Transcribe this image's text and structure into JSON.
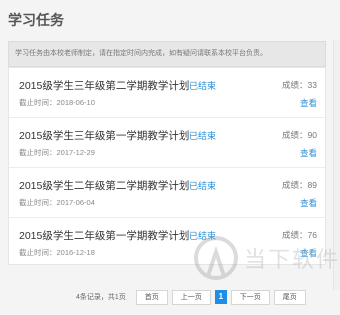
{
  "page": {
    "title": "学习任务"
  },
  "notice": {
    "text": "学习任务由本校老师制定，请在指定时间内完成，如有疑问请联系本校平台负责。"
  },
  "tasks": [
    {
      "title": "2015级学生三年级第二学期教学计划",
      "status": "已结束",
      "deadline": "截止时间：2018-06-10",
      "score": "成绩：33",
      "action": "查看"
    },
    {
      "title": "2015级学生三年级第一学期教学计划",
      "status": "已结束",
      "deadline": "截止时间：2017-12-29",
      "score": "成绩：90",
      "action": "查看"
    },
    {
      "title": "2015级学生二年级第二学期教学计划",
      "status": "已结束",
      "deadline": "截止时间：2017-06-04",
      "score": "成绩：89",
      "action": "查看"
    },
    {
      "title": "2015级学生二年级第一学期教学计划",
      "status": "已结束",
      "deadline": "截止时间：2016-12-18",
      "score": "成绩：76",
      "action": "查看"
    }
  ],
  "pagination": {
    "summary": "4条记录，共1页",
    "first": "首页",
    "prev": "上一页",
    "current": "1",
    "next": "下一页",
    "last": "尾页"
  },
  "watermark": {
    "text": "当下软件园"
  },
  "colors": {
    "accent": "#1f8ee6",
    "link": "#2b8fd6",
    "background": "#f4f4f4"
  }
}
